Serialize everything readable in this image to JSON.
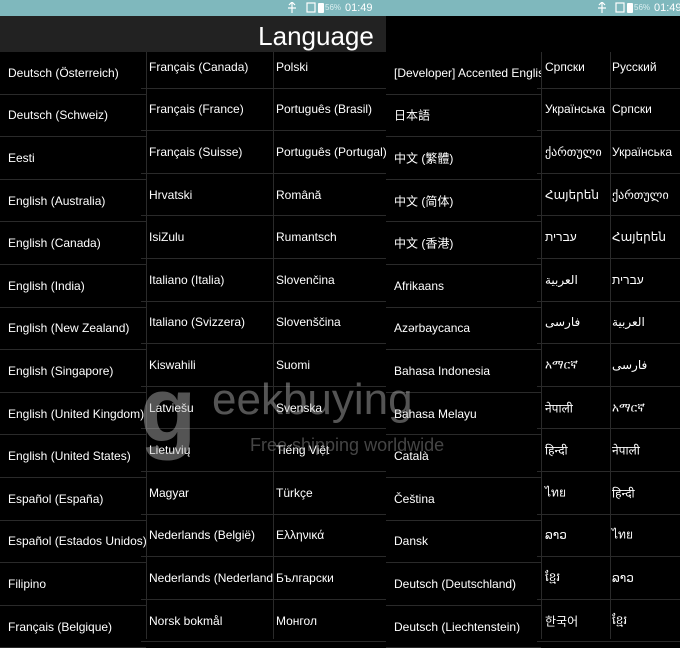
{
  "status_bar": {
    "time_left": "01:49",
    "time_right": "01:49",
    "battery_left": "56%",
    "battery_right": "56%"
  },
  "header": {
    "title": "Language"
  },
  "left_panel": {
    "col1": [
      "Deutsch (Österreich)",
      "Deutsch (Schweiz)",
      "Eesti",
      "English (Australia)",
      "English (Canada)",
      "English (India)",
      "English (New Zealand)",
      "English (Singapore)",
      "English (United Kingdom)",
      "English (United States)",
      "Español (España)",
      "Español (Estados Unidos)",
      "Filipino",
      "Français (Belgique)"
    ],
    "col2": [
      "Français (Canada)",
      "Français (France)",
      "Français (Suisse)",
      "Hrvatski",
      "IsiZulu",
      "Italiano (Italia)",
      "Italiano (Svizzera)",
      "Kiswahili",
      "Latviešu",
      "Lietuvių",
      "Magyar",
      "Nederlands (België)",
      "Nederlands (Nederland)",
      "Norsk bokmål"
    ],
    "col3": [
      "Polski",
      "Português (Brasil)",
      "Português (Portugal)",
      "Română",
      "Rumantsch",
      "Slovenčina",
      "Slovenščina",
      "Suomi",
      "Svenska",
      "Tiếng Việt",
      "Türkçe",
      "Ελληνικά",
      "Български",
      "Монгол"
    ]
  },
  "right_panel": {
    "col1": [
      "[Developer] Accented English",
      "日本語",
      "中文 (繁體)",
      "中文 (简体)",
      "中文 (香港)",
      "Afrikaans",
      "Azərbaycanca",
      "Bahasa Indonesia",
      "Bahasa Melayu",
      "Català",
      "Čeština",
      "Dansk",
      "Deutsch (Deutschland)",
      "Deutsch (Liechtenstein)"
    ],
    "col2": [
      "Српски",
      "Українська",
      "ქართული",
      "Հայերեն",
      "עברית",
      "العربية",
      "فارسی",
      "አማርኛ",
      "नेपाली",
      "हिन्दी",
      "ไทย",
      "ລາວ",
      "ខ្មែរ",
      "한국어"
    ],
    "col3": [
      "Русский",
      "Српски",
      "Українська",
      "ქართული",
      "Հայերեն",
      "עברית",
      "العربية",
      "فارسی",
      "አማርኛ",
      "नेपाली",
      "हिन्दी",
      "ไทย",
      "ລາວ",
      "ខ្មែរ"
    ]
  },
  "watermark": {
    "brand": "eekbuying",
    "tagline": "Free shipping worldwide"
  }
}
